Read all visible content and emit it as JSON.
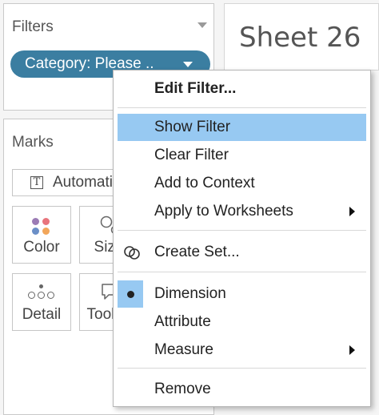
{
  "filters": {
    "title": "Filters",
    "pill_label": "Category: Please .."
  },
  "sheet": {
    "title": "Sheet 26"
  },
  "marks": {
    "title": "Marks",
    "mark_type": "Automatic",
    "cards": {
      "color": "Color",
      "size": "Size",
      "detail": "Detail",
      "tooltip": "Tooltip"
    }
  },
  "context_menu": {
    "items": [
      {
        "label": "Edit Filter..."
      },
      {
        "label": "Show Filter"
      },
      {
        "label": "Clear Filter"
      },
      {
        "label": "Add to Context"
      },
      {
        "label": "Apply to Worksheets"
      },
      {
        "label": "Create Set..."
      },
      {
        "label": "Dimension"
      },
      {
        "label": "Attribute"
      },
      {
        "label": "Measure"
      },
      {
        "label": "Remove"
      }
    ],
    "highlight_color": "#97c9f2"
  },
  "colors": {
    "pill": "#3b7ea1",
    "color_dots": [
      "#9b7bb5",
      "#e8747c",
      "#6b8fc7",
      "#f2a65a"
    ]
  },
  "icons": {
    "mark_type": "text-mark-icon",
    "color": "color-dots-icon",
    "size": "size-circles-icon",
    "detail": "detail-dots-icon",
    "tooltip": "tooltip-speech-icon",
    "create_set": "venn-set-icon",
    "selected": "bullet-icon"
  }
}
